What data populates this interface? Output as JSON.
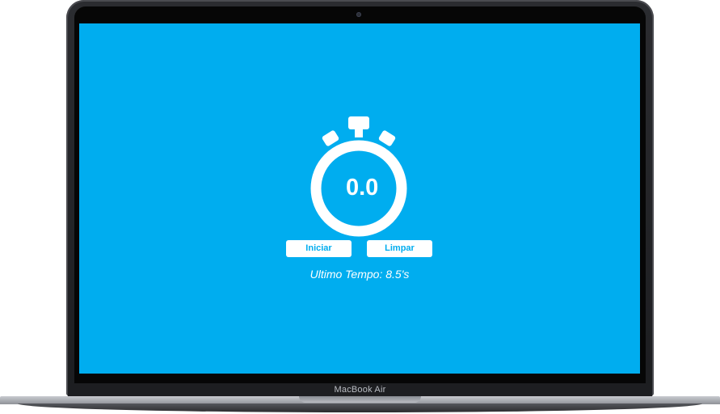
{
  "device": {
    "brand_label": "MacBook Air"
  },
  "stopwatch": {
    "display": "0.0",
    "start_label": "Iniciar",
    "clear_label": "Limpar",
    "last_time_text": "Ultimo Tempo: 8.5's"
  },
  "colors": {
    "background": "#00adef",
    "foreground": "#ffffff",
    "button_text": "#00adef"
  },
  "icons": {
    "stopwatch": "stopwatch-icon"
  }
}
